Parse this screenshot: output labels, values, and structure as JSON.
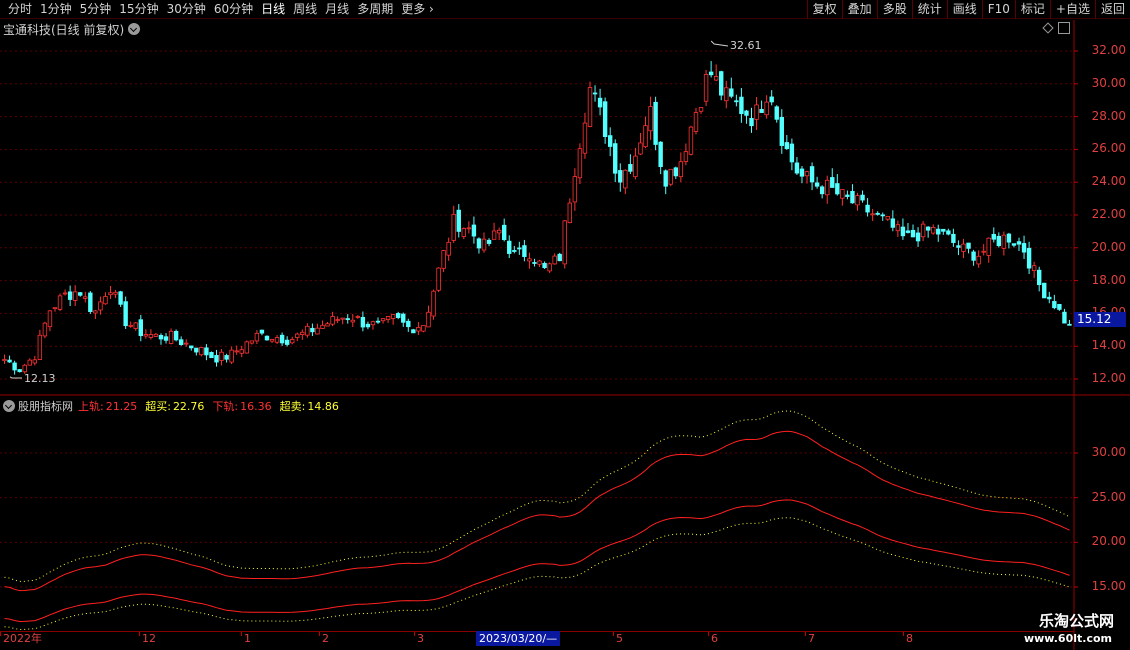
{
  "toolbar": {
    "periods": [
      "分时",
      "1分钟",
      "5分钟",
      "15分钟",
      "30分钟",
      "60分钟",
      "日线",
      "周线",
      "月线",
      "多周期",
      "更多"
    ],
    "active_period": "日线",
    "buttons": [
      "复权",
      "叠加",
      "多股",
      "统计",
      "画线",
      "F10",
      "标记",
      "+自选",
      "返回"
    ]
  },
  "main_panel": {
    "stock_title": "宝通科技(日线 前复权)",
    "high_label": "32.61",
    "low_label": "12.13",
    "current_price": "15.12",
    "y_ticks": [
      "32.00",
      "30.00",
      "28.00",
      "26.00",
      "24.00",
      "22.00",
      "20.00",
      "18.00",
      "16.00",
      "14.00",
      "12.00"
    ]
  },
  "indicator_panel": {
    "name": "股朋指标网",
    "values": [
      {
        "key": "上轨:",
        "value": "21.25",
        "color": "#ff3232"
      },
      {
        "key": "超买:",
        "value": "22.76",
        "color": "#ffff33"
      },
      {
        "key": "下轨:",
        "value": "16.36",
        "color": "#ff3232"
      },
      {
        "key": "超卖:",
        "value": "14.86",
        "color": "#ffff33"
      }
    ],
    "y_ticks": [
      "30.00",
      "25.00",
      "20.00",
      "15.00"
    ]
  },
  "date_axis": {
    "ticks": [
      "2022年",
      "12",
      "1",
      "2",
      "3",
      "5",
      "6",
      "7",
      "8"
    ],
    "cursor_label": "2023/03/20/—"
  },
  "watermark": {
    "title": "乐淘公式网",
    "url": "www.60lt.com"
  },
  "colors": {
    "up": "#ff3232",
    "down": "#54ffff",
    "upper_band": "#ff2020",
    "overbought": "#ffff33",
    "grid": "#5a0000"
  },
  "chart_data": {
    "type": "candlestick",
    "series": [
      {
        "name": "上轨",
        "last": 21.25
      },
      {
        "name": "超买",
        "last": 22.76
      },
      {
        "name": "下轨",
        "last": 16.36
      },
      {
        "name": "超卖",
        "last": 14.86
      }
    ],
    "close_path": [
      13.2,
      12.6,
      13.4,
      16.2,
      17.1,
      17.4,
      16.0,
      17.8,
      15.6,
      14.9,
      14.6,
      14.6,
      14.2,
      13.8,
      13.3,
      13.4,
      14.1,
      14.7,
      14.6,
      14.4,
      14.8,
      15.2,
      15.6,
      15.9,
      15.4,
      15.2,
      15.7,
      15.1,
      15.4,
      18.8,
      21.7,
      21.1,
      20.0,
      21.0,
      19.5,
      19.8,
      18.6,
      19.4,
      24.8,
      29.8,
      27.4,
      24.2,
      25.6,
      28.5,
      24.3,
      25.1,
      28.1,
      30.8,
      29.2,
      28.6,
      27.9,
      29.9,
      26.2,
      24.4,
      23.9,
      23.6,
      23.0,
      22.6,
      22.0,
      21.4,
      20.5,
      20.9,
      21.1,
      20.5,
      19.8,
      19.6,
      20.4,
      20.7,
      19.9,
      17.7,
      16.6,
      15.12
    ]
  }
}
